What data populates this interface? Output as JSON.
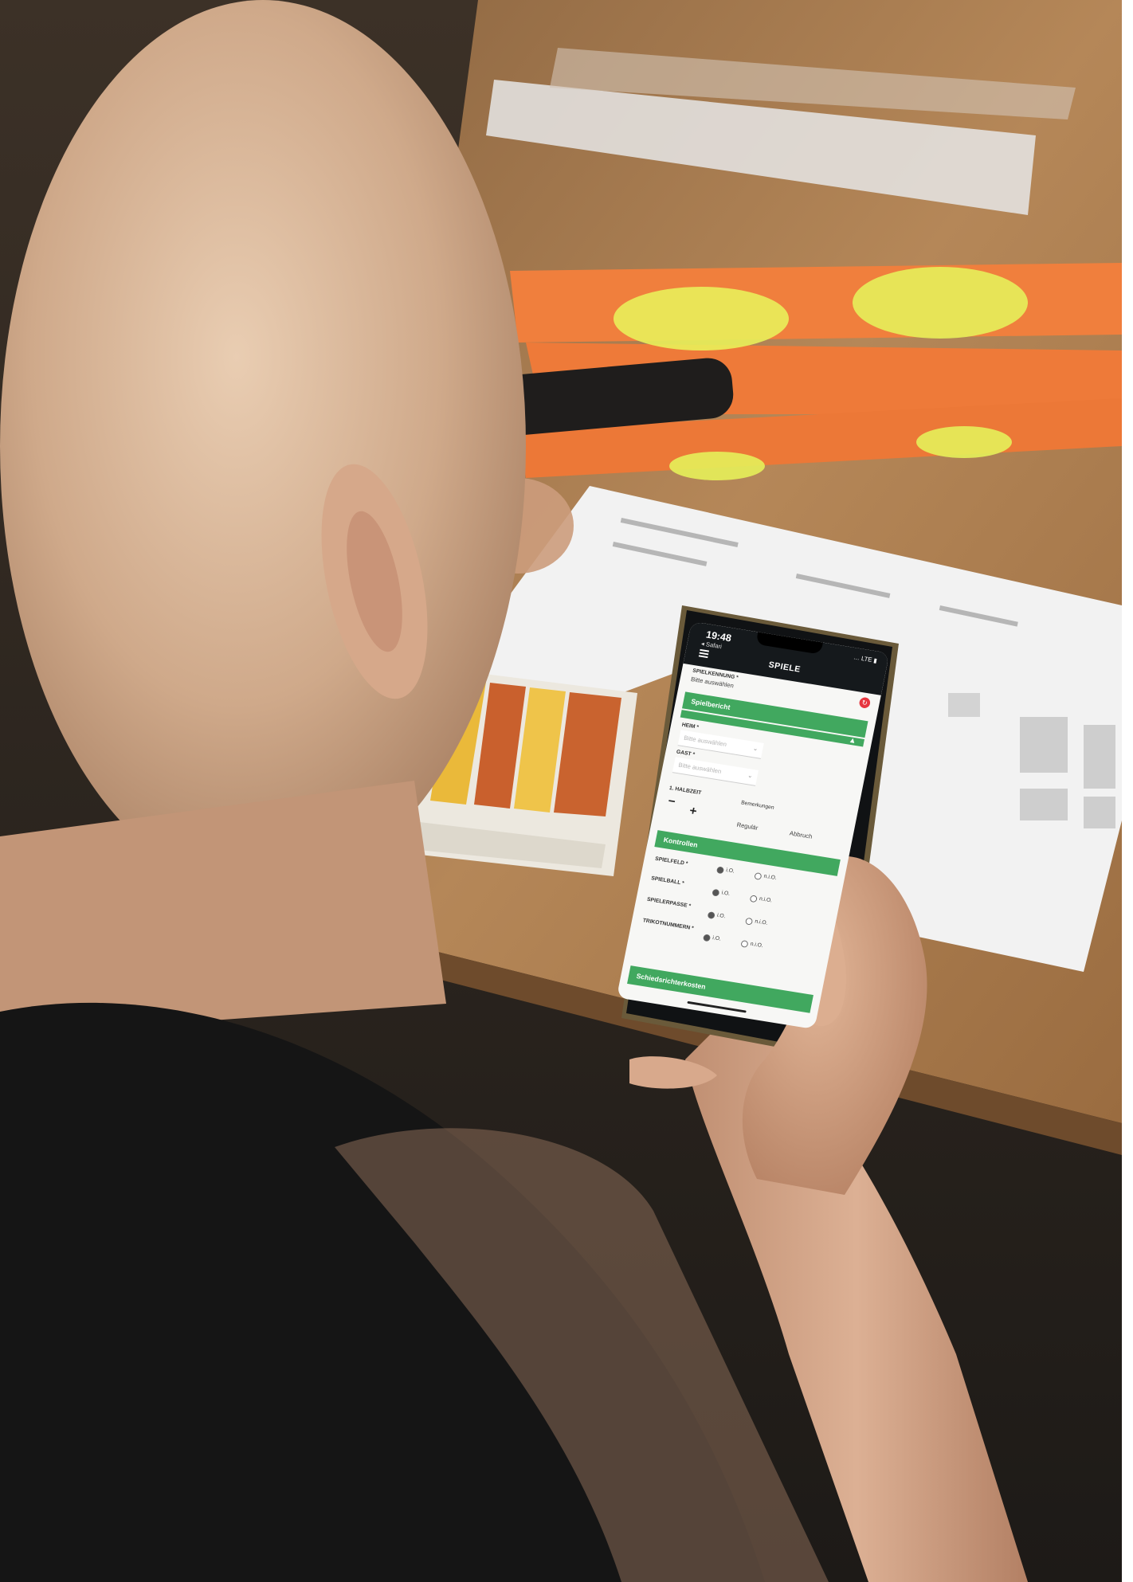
{
  "photo": {
    "subject": "person holding smartphone over a table with papers and cards"
  },
  "phone": {
    "status_time": "19:48",
    "back_label": "◂ Safari",
    "status_icons": "… LTE ▮",
    "app_title": "SPIELE",
    "top_field_label": "SPIELKENNUNG *",
    "top_field_value": "Bitte auswählen",
    "section_1_title": "Spielbericht",
    "field_a_label": "HEIM *",
    "field_a_placeholder": "Bitte auswählen",
    "field_b_label": "GAST *",
    "field_b_placeholder": "Bitte auswählen",
    "halftime_label": "1. HALBZEIT",
    "minus": "−",
    "plus": "+",
    "remark_label": "Bemerkungen",
    "result_left": "Regulär",
    "result_right": "Abbruch",
    "section_2_title": "Kontrollen",
    "controls": [
      {
        "label": "SPIELFELD *",
        "opt_yes": "i.O.",
        "opt_no": "n.i.O."
      },
      {
        "label": "SPIELBALL *",
        "opt_yes": "i.O.",
        "opt_no": "n.i.O."
      },
      {
        "label": "SPIELERPASSE *",
        "opt_yes": "i.O.",
        "opt_no": "n.i.O."
      },
      {
        "label": "TRIKOTNUMMERN *",
        "opt_yes": "i.O.",
        "opt_no": "n.i.O."
      }
    ],
    "bottom_button": "Schiedsrichterkosten",
    "accent_color": "#41a85f",
    "refresh_icon": "refresh-icon"
  }
}
